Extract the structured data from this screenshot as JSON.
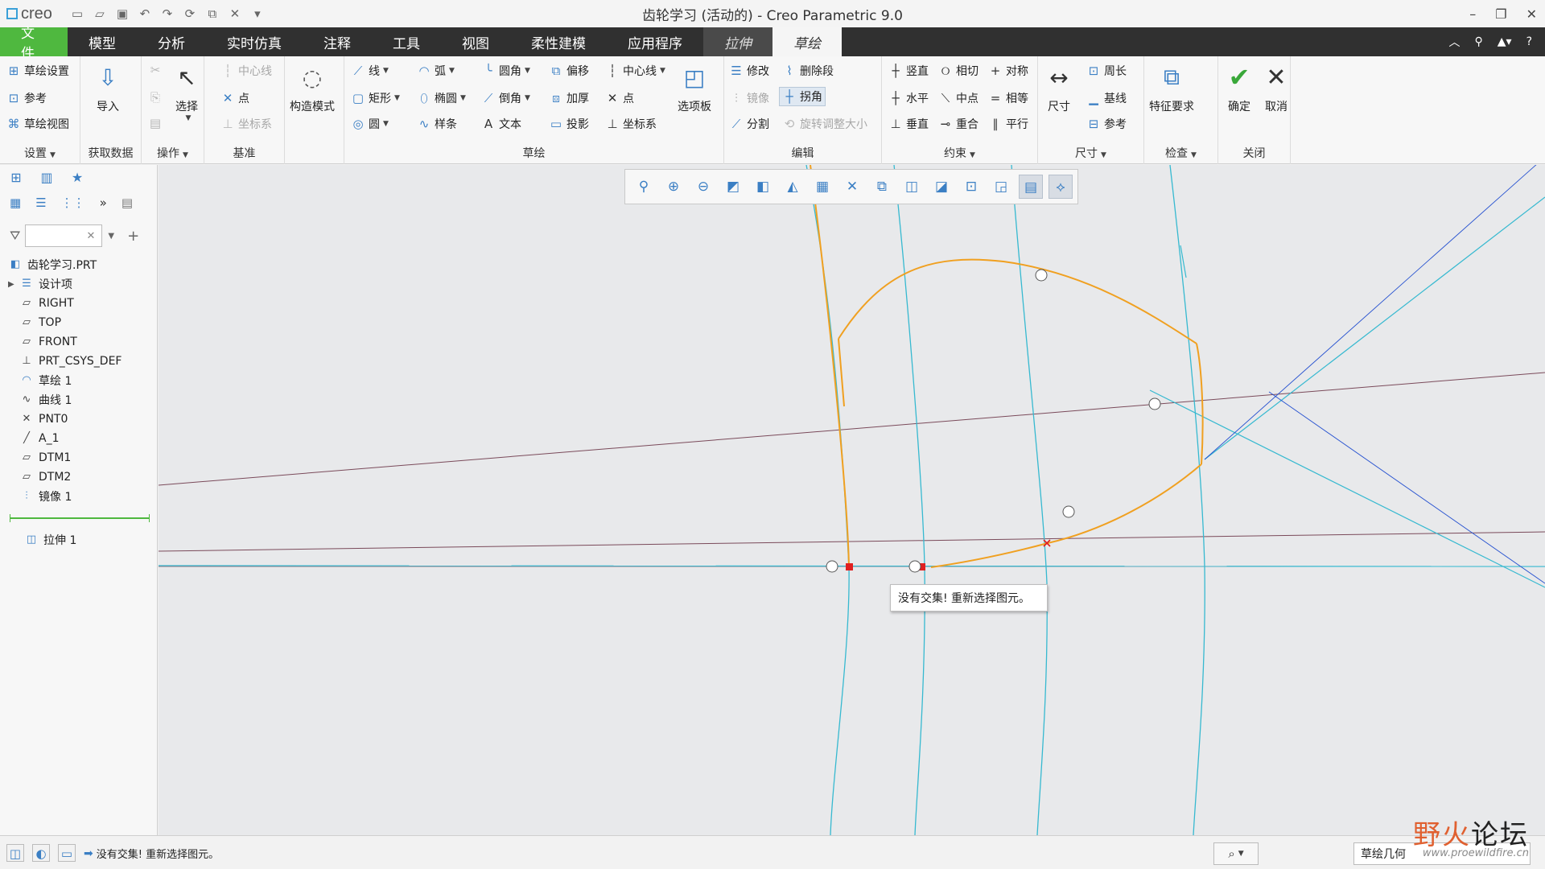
{
  "app": {
    "logo": "creo",
    "title": "齿轮学习 (活动的) - Creo Parametric 9.0"
  },
  "tabs": [
    {
      "label": "文件"
    },
    {
      "label": "模型"
    },
    {
      "label": "分析"
    },
    {
      "label": "实时仿真"
    },
    {
      "label": "注释"
    },
    {
      "label": "工具"
    },
    {
      "label": "视图"
    },
    {
      "label": "柔性建模"
    },
    {
      "label": "应用程序"
    },
    {
      "label": "拉伸"
    },
    {
      "label": "草绘"
    }
  ],
  "ribbon": {
    "setup": {
      "sketch_setup": "草绘设置",
      "references": "参考",
      "sketch_view": "草绘视图",
      "label": "设置"
    },
    "get_data": {
      "import": "导入",
      "label": "获取数据"
    },
    "operations": {
      "select": "选择",
      "label": "操作"
    },
    "datum": {
      "centerline": "中心线",
      "point": "点",
      "csys": "坐标系",
      "label": "基准"
    },
    "construction": {
      "mode": "构造模式"
    },
    "sketching": {
      "line": "线",
      "rectangle": "矩形",
      "circle": "圆",
      "arc": "弧",
      "ellipse": "椭圆",
      "spline": "样条",
      "fillet": "圆角",
      "chamfer": "倒角",
      "text": "文本",
      "offset": "偏移",
      "thicken": "加厚",
      "project": "投影",
      "centerline": "中心线",
      "point": "点",
      "csys": "坐标系",
      "palette": "选项板",
      "label": "草绘"
    },
    "editing": {
      "modify": "修改",
      "delete_segment": "删除段",
      "mirror": "镜像",
      "corner": "拐角",
      "divide": "分割",
      "rotate_resize": "旋转调整大小",
      "label": "编辑"
    },
    "constrain": {
      "vertical": "竖直",
      "tangent": "相切",
      "symmetric": "对称",
      "horizontal": "水平",
      "midpoint": "中点",
      "equal": "相等",
      "perpendicular": "垂直",
      "coincident": "重合",
      "parallel": "平行",
      "label": "约束"
    },
    "dimension": {
      "normal": "尺寸",
      "perimeter": "周长",
      "baseline": "基线",
      "reference": "参考",
      "label": "尺寸"
    },
    "inspect": {
      "feature_requirements": "特征要求",
      "label": "检查"
    },
    "close": {
      "ok": "确定",
      "cancel": "取消",
      "label": "关闭"
    }
  },
  "model_tree": {
    "items": [
      {
        "label": "齿轮学习.PRT",
        "icon": "part-icon"
      },
      {
        "label": "设计项",
        "icon": "design-items-icon"
      },
      {
        "label": "RIGHT",
        "icon": "datum-plane-icon"
      },
      {
        "label": "TOP",
        "icon": "datum-plane-icon"
      },
      {
        "label": "FRONT",
        "icon": "datum-plane-icon"
      },
      {
        "label": "PRT_CSYS_DEF",
        "icon": "csys-icon"
      },
      {
        "label": "草绘 1",
        "icon": "sketch-icon"
      },
      {
        "label": "曲线 1",
        "icon": "curve-icon"
      },
      {
        "label": "PNT0",
        "icon": "datum-point-icon"
      },
      {
        "label": "A_1",
        "icon": "axis-icon"
      },
      {
        "label": "DTM1",
        "icon": "datum-plane-icon"
      },
      {
        "label": "DTM2",
        "icon": "datum-plane-icon"
      },
      {
        "label": "镜像 1",
        "icon": "mirror-icon"
      }
    ],
    "active_feature": "拉伸 1"
  },
  "tooltip": "没有交集! 重新选择图元。",
  "status": {
    "message": "没有交集! 重新选择图元。",
    "filter": "草绘几何"
  },
  "watermark": {
    "brand_a": "野火",
    "brand_b": "论坛",
    "url": "www.proewildfire.cn"
  },
  "colors": {
    "file_tab": "#4fb83f",
    "sketch_entity": "#f0a020",
    "construction": "#36b9d0",
    "reference_line": "#7a4a5a",
    "error_marker": "#e02020"
  }
}
